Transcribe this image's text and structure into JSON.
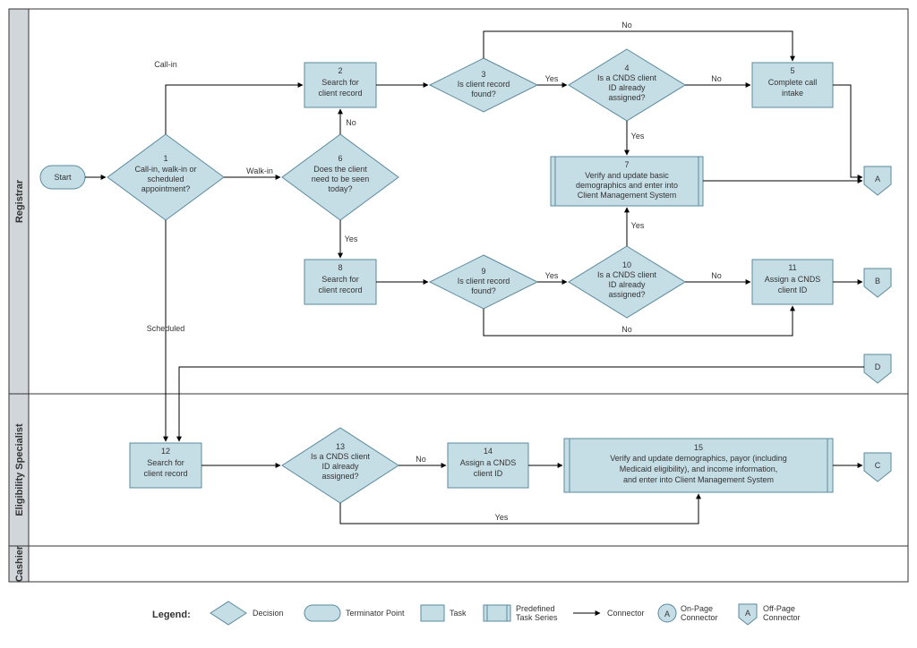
{
  "swimlanes": [
    {
      "label": "Registrar"
    },
    {
      "label": "Eligibility Specialist"
    },
    {
      "label": "Cashier"
    }
  ],
  "start": "Start",
  "n1": {
    "num": "1",
    "l1": "Call-in, walk-in or",
    "l2": "scheduled",
    "l3": "appointment?"
  },
  "n2": {
    "num": "2",
    "l1": "Search for",
    "l2": "client record"
  },
  "n3": {
    "num": "3",
    "l1": "Is client record",
    "l2": "found?"
  },
  "n4": {
    "num": "4",
    "l1": "Is a CNDS client",
    "l2": "ID already",
    "l3": "assigned?"
  },
  "n5": {
    "num": "5",
    "l1": "Complete call",
    "l2": "intake"
  },
  "n6": {
    "num": "6",
    "l1": "Does the client",
    "l2": "need to be seen",
    "l3": "today?"
  },
  "n7": {
    "num": "7",
    "l1": "Verify and update basic",
    "l2": "demographics and enter into",
    "l3": "Client Management System"
  },
  "n8": {
    "num": "8",
    "l1": "Search for",
    "l2": "client record"
  },
  "n9": {
    "num": "9",
    "l1": "Is client record",
    "l2": "found?"
  },
  "n10": {
    "num": "10",
    "l1": "Is a CNDS client",
    "l2": "ID already",
    "l3": "assigned?"
  },
  "n11": {
    "num": "11",
    "l1": "Assign a CNDS",
    "l2": "client ID"
  },
  "n12": {
    "num": "12",
    "l1": "Search for",
    "l2": "client record"
  },
  "n13": {
    "num": "13",
    "l1": "Is a CNDS client",
    "l2": "ID already",
    "l3": "assigned?"
  },
  "n14": {
    "num": "14",
    "l1": "Assign a CNDS",
    "l2": "client ID"
  },
  "n15": {
    "num": "15",
    "l1": "Verify and update demographics, payor (including",
    "l2": "Medicaid eligibility), and income information,",
    "l3": "and enter into Client Management System"
  },
  "offA": "A",
  "offB": "B",
  "offC": "C",
  "offD": "D",
  "edges": {
    "callin": "Call-in",
    "walkin": "Walk-in",
    "scheduled": "Scheduled",
    "yes": "Yes",
    "no": "No"
  },
  "legend": {
    "title": "Legend:",
    "decision": "Decision",
    "terminator": "Terminator Point",
    "task": "Task",
    "predef": "Predefined\nTask Series",
    "connector": "Connector",
    "onpage": "On-Page\nConnector",
    "offpage": "Off-Page\nConnector"
  }
}
